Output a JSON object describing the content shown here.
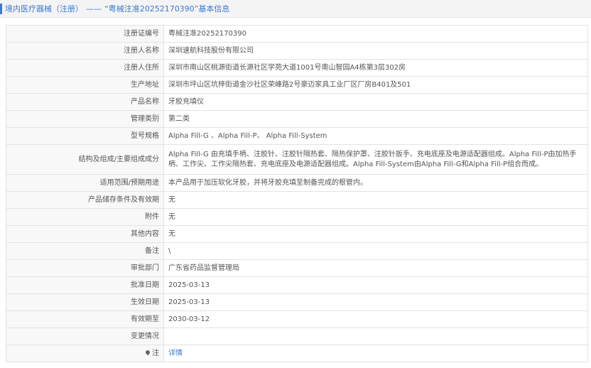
{
  "breadcrumb": {
    "part1": "境内医疗器械（注册）",
    "separator": "——",
    "part2": "“粤械注准20252170390”基本信息"
  },
  "rows": [
    {
      "key": "注册证编号",
      "value": "粤械注准20252170390"
    },
    {
      "key": "注册人名称",
      "value": "深圳速航科技股份有限公司"
    },
    {
      "key": "注册人住所",
      "value": "深圳市南山区桃源街道长源社区学苑大道1001号南山智园A4栋第3层302房"
    },
    {
      "key": "生产地址",
      "value": "深圳市坪山区坑梓街道金沙社区荣峰路2号豪迈家具工业厂区厂房B401及501"
    },
    {
      "key": "产品名称",
      "value": "牙胶充填仪"
    },
    {
      "key": "管理类别",
      "value": "第二类"
    },
    {
      "key": "型号规格",
      "value": "Alpha Fill-G 、Alpha Fill-P、 Alpha Fill-System"
    },
    {
      "key": "结构及组成/主要组成成分",
      "value": "Alpha Fill-G 由充填手柄、注胶针、注胶针隔热套、隔热保护罩、注胶针扳手、充电底座及电源适配器组成。Alpha Fill-P由加热手柄、工作尖、工作尖隔热套、充电底座及电源适配器组成。Alpha Fill-System由Alpha Fill-G和Alpha Fill-P组合而成。"
    },
    {
      "key": "适用范围/预期用途",
      "value": "本产品用于加压软化牙胶，并将牙胶充填至制备完成的根管内。"
    },
    {
      "key": "产品储存条件及有效期",
      "value": "无"
    },
    {
      "key": "附件",
      "value": "无"
    },
    {
      "key": "其他内容",
      "value": "无"
    },
    {
      "key": "备注",
      "value": "\\"
    },
    {
      "key": "审批部门",
      "value": "广东省药品监督管理局"
    },
    {
      "key": "批准日期",
      "value": "2025-03-13"
    },
    {
      "key": "生效日期",
      "value": "2025-03-13"
    },
    {
      "key": "有效期至",
      "value": "2030-03-12"
    },
    {
      "key": "变更情况",
      "value": ""
    }
  ],
  "note": {
    "key": "注",
    "link_label": "详情",
    "icon": "map-pin-icon"
  }
}
